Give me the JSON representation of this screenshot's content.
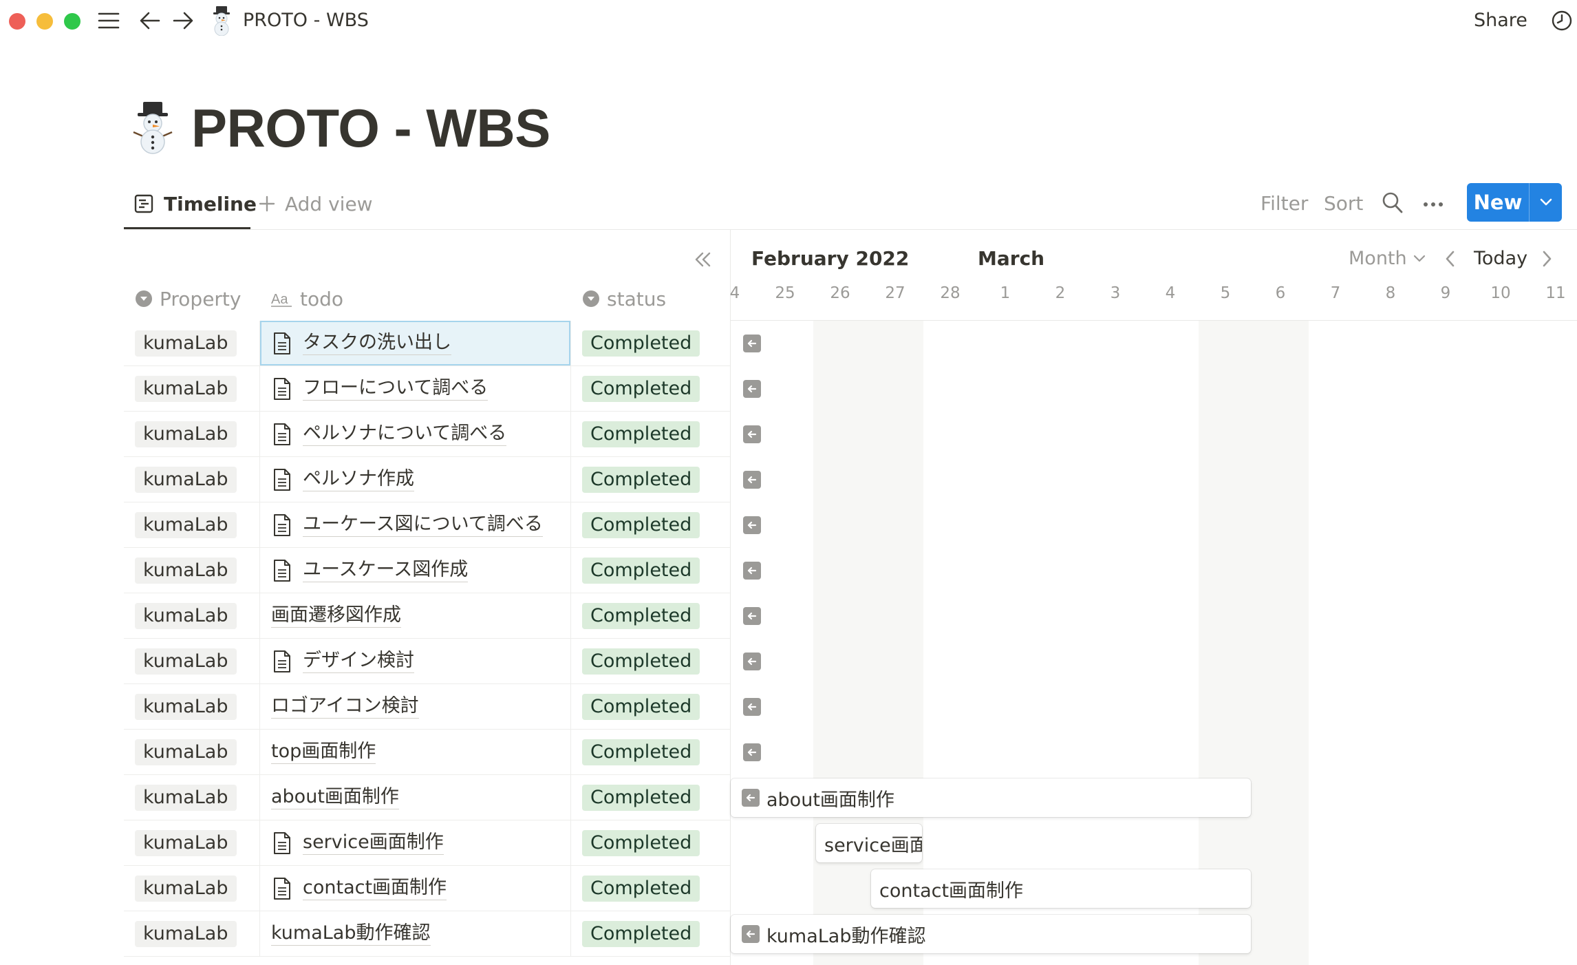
{
  "window": {
    "title": "PROTO - WBS",
    "share_label": "Share"
  },
  "page": {
    "title": "PROTO - WBS",
    "icon": "snowman-emoji"
  },
  "views": {
    "tabs": [
      {
        "label": "Timeline",
        "active": true
      }
    ],
    "add_view_label": "Add view",
    "actions": {
      "filter": "Filter",
      "sort": "Sort",
      "new": "New"
    }
  },
  "table": {
    "columns": [
      {
        "label": "Property",
        "icon": "select-icon"
      },
      {
        "label": "todo",
        "icon": "title-icon"
      },
      {
        "label": "status",
        "icon": "select-icon"
      }
    ],
    "rows": [
      {
        "property": "kumaLab",
        "todo": "タスクの洗い出し",
        "status": "Completed",
        "has_page_icon": true,
        "selected": true
      },
      {
        "property": "kumaLab",
        "todo": "フローについて調べる",
        "status": "Completed",
        "has_page_icon": true
      },
      {
        "property": "kumaLab",
        "todo": "ペルソナについて調べる",
        "status": "Completed",
        "has_page_icon": true
      },
      {
        "property": "kumaLab",
        "todo": "ペルソナ作成",
        "status": "Completed",
        "has_page_icon": true
      },
      {
        "property": "kumaLab",
        "todo": "ユーケース図について調べる",
        "status": "Completed",
        "has_page_icon": true
      },
      {
        "property": "kumaLab",
        "todo": "ユースケース図作成",
        "status": "Completed",
        "has_page_icon": true
      },
      {
        "property": "kumaLab",
        "todo": "画面遷移図作成",
        "status": "Completed",
        "has_page_icon": false
      },
      {
        "property": "kumaLab",
        "todo": "デザイン検討",
        "status": "Completed",
        "has_page_icon": true
      },
      {
        "property": "kumaLab",
        "todo": "ロゴアイコン検討",
        "status": "Completed",
        "has_page_icon": false
      },
      {
        "property": "kumaLab",
        "todo": "top画面制作",
        "status": "Completed",
        "has_page_icon": false
      },
      {
        "property": "kumaLab",
        "todo": "about画面制作",
        "status": "Completed",
        "has_page_icon": false
      },
      {
        "property": "kumaLab",
        "todo": "service画面制作",
        "status": "Completed",
        "has_page_icon": true
      },
      {
        "property": "kumaLab",
        "todo": "contact画面制作",
        "status": "Completed",
        "has_page_icon": true
      },
      {
        "property": "kumaLab",
        "todo": "kumaLab動作確認",
        "status": "Completed",
        "has_page_icon": false
      }
    ]
  },
  "timeline": {
    "months": [
      "February 2022",
      "March"
    ],
    "zoom_label": "Month",
    "today_label": "Today",
    "days": [
      "4",
      "25",
      "26",
      "27",
      "28",
      "1",
      "2",
      "3",
      "4",
      "5",
      "6",
      "7",
      "8",
      "9",
      "10",
      "11"
    ],
    "bars": [
      {
        "row": 10,
        "label": "about画面制作",
        "extends_before_view": true
      },
      {
        "row": 11,
        "label": "service画面制作",
        "extends_before_view": false
      },
      {
        "row": 12,
        "label": "contact画面制作",
        "extends_before_view": false
      },
      {
        "row": 13,
        "label": "kumaLab動作確認",
        "extends_before_view": true
      }
    ],
    "offscreen_arrow_rows": [
      0,
      1,
      2,
      3,
      4,
      5,
      6,
      7,
      8,
      9
    ]
  },
  "colors": {
    "accent": "#2383e2",
    "status_completed_bg": "#dbeddb",
    "status_completed_text": "#1c3829",
    "selected_cell_bg": "#e7f3f8",
    "weekend_bg": "#f7f7f5"
  }
}
